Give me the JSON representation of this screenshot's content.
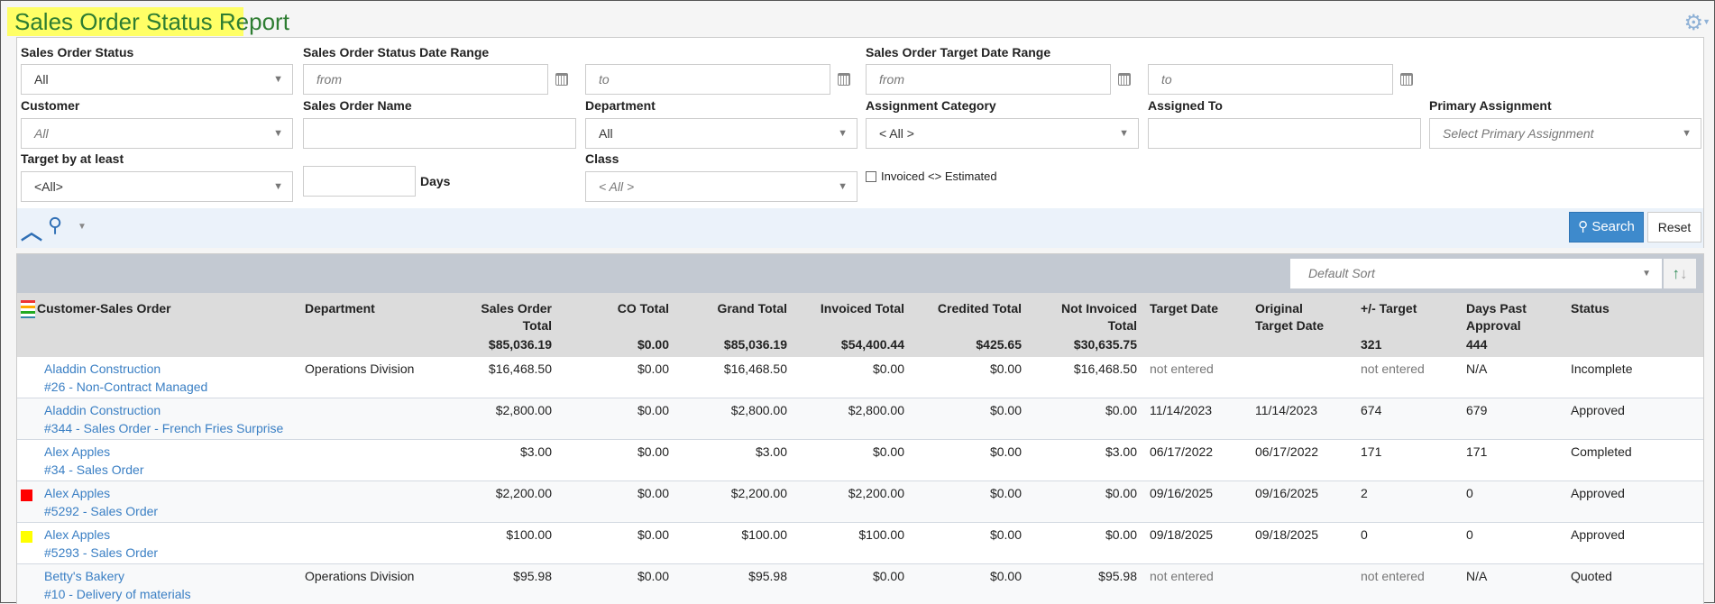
{
  "title": "Sales Order Status Report",
  "filters": {
    "so_status": {
      "label": "Sales Order Status",
      "value": "All"
    },
    "status_range": {
      "label": "Sales Order Status Date Range",
      "from": "from",
      "to": "to"
    },
    "target_range": {
      "label": "Sales Order Target Date Range",
      "from": "from",
      "to": "to"
    },
    "customer": {
      "label": "Customer",
      "value": "All"
    },
    "so_name": {
      "label": "Sales Order Name",
      "value": ""
    },
    "department": {
      "label": "Department",
      "value": "All"
    },
    "assign_cat": {
      "label": "Assignment Category",
      "value": "< All >"
    },
    "assigned_to": {
      "label": "Assigned To",
      "value": ""
    },
    "primary": {
      "label": "Primary Assignment",
      "placeholder": "Select Primary Assignment"
    },
    "target_by": {
      "label": "Target by at least",
      "value": "<All>",
      "days_label": "Days"
    },
    "class": {
      "label": "Class",
      "value": "< All >"
    },
    "invoiced_checkbox": {
      "label": "Invoiced <> Estimated",
      "checked": false
    }
  },
  "toolbar": {
    "search": "Search",
    "reset": "Reset"
  },
  "sort": {
    "placeholder": "Default Sort"
  },
  "columns": [
    {
      "label": "Customer-Sales Order",
      "total": ""
    },
    {
      "label": "Department",
      "total": ""
    },
    {
      "label": "Sales Order Total",
      "total": "$85,036.19"
    },
    {
      "label": "CO Total",
      "total": "$0.00"
    },
    {
      "label": "Grand Total",
      "total": "$85,036.19"
    },
    {
      "label": "Invoiced Total",
      "total": "$54,400.44"
    },
    {
      "label": "Credited Total",
      "total": "$425.65"
    },
    {
      "label": "Not Invoiced Total",
      "total": "$30,635.75"
    },
    {
      "label": "Target Date",
      "total": ""
    },
    {
      "label": "Original Target Date",
      "total": ""
    },
    {
      "label": "+/- Target",
      "total": "321"
    },
    {
      "label": "Days Past Approval",
      "total": "444"
    },
    {
      "label": "Status",
      "total": ""
    }
  ],
  "rows": [
    {
      "indicator": "",
      "customer": "Aladdin Construction",
      "order": "#26 - Non-Contract Managed",
      "department": "Operations Division",
      "so_total": "$16,468.50",
      "co_total": "$0.00",
      "grand_total": "$16,468.50",
      "invoiced": "$0.00",
      "credited": "$0.00",
      "not_invoiced": "$16,468.50",
      "target_date": "not entered",
      "orig_target": "",
      "plus_minus": "not entered",
      "days_past": "N/A",
      "status": "Incomplete"
    },
    {
      "indicator": "",
      "customer": "Aladdin Construction",
      "order": "#344 - Sales Order - French Fries Surprise",
      "department": "",
      "so_total": "$2,800.00",
      "co_total": "$0.00",
      "grand_total": "$2,800.00",
      "invoiced": "$2,800.00",
      "credited": "$0.00",
      "not_invoiced": "$0.00",
      "target_date": "11/14/2023",
      "orig_target": "11/14/2023",
      "plus_minus": "674",
      "days_past": "679",
      "status": "Approved"
    },
    {
      "indicator": "",
      "customer": "Alex Apples",
      "order": "#34 - Sales Order",
      "department": "",
      "so_total": "$3.00",
      "co_total": "$0.00",
      "grand_total": "$3.00",
      "invoiced": "$0.00",
      "credited": "$0.00",
      "not_invoiced": "$3.00",
      "target_date": "06/17/2022",
      "orig_target": "06/17/2022",
      "plus_minus": "171",
      "days_past": "171",
      "status": "Completed"
    },
    {
      "indicator": "#ff0000",
      "customer": "Alex Apples",
      "order": "#5292 - Sales Order",
      "department": "",
      "so_total": "$2,200.00",
      "co_total": "$0.00",
      "grand_total": "$2,200.00",
      "invoiced": "$2,200.00",
      "credited": "$0.00",
      "not_invoiced": "$0.00",
      "target_date": "09/16/2025",
      "orig_target": "09/16/2025",
      "plus_minus": "2",
      "days_past": "0",
      "status": "Approved"
    },
    {
      "indicator": "#ffff00",
      "customer": "Alex Apples",
      "order": "#5293 - Sales Order",
      "department": "",
      "so_total": "$100.00",
      "co_total": "$0.00",
      "grand_total": "$100.00",
      "invoiced": "$100.00",
      "credited": "$0.00",
      "not_invoiced": "$0.00",
      "target_date": "09/18/2025",
      "orig_target": "09/18/2025",
      "plus_minus": "0",
      "days_past": "0",
      "status": "Approved"
    },
    {
      "indicator": "",
      "customer": "Betty's Bakery",
      "order": "#10 - Delivery of materials",
      "department": "Operations Division",
      "so_total": "$95.98",
      "co_total": "$0.00",
      "grand_total": "$95.98",
      "invoiced": "$0.00",
      "credited": "$0.00",
      "not_invoiced": "$95.98",
      "target_date": "not entered",
      "orig_target": "",
      "plus_minus": "not entered",
      "days_past": "N/A",
      "status": "Quoted"
    }
  ],
  "colors": {
    "title_bg": "#ffff66",
    "title_text": "#2e7d32",
    "link": "#3a7fc4",
    "search_button": "#3e8acc"
  }
}
